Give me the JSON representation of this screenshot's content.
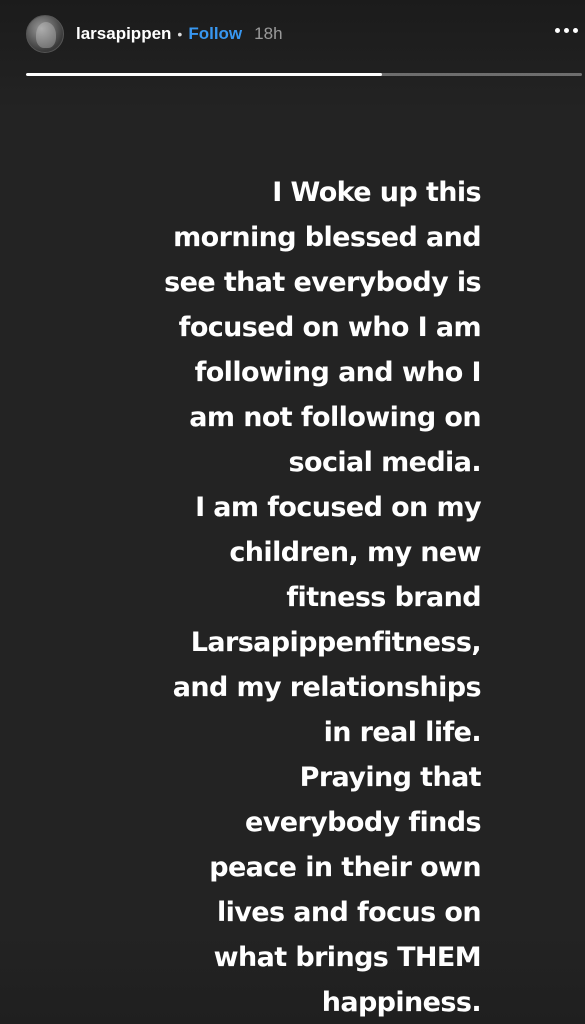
{
  "header": {
    "username": "larsapippen",
    "separator": "•",
    "follow_label": "Follow",
    "timestamp": "18h",
    "more_icon": "more-horizontal-icon"
  },
  "progress": {
    "fraction": 0.64
  },
  "story": {
    "lines": [
      "I Woke up this",
      "morning blessed and",
      "see that everybody is",
      "focused on who I am",
      "following and who I",
      "am not following on",
      "social media.",
      "I am focused on my",
      "children, my new",
      "fitness brand",
      "Larsapippenfitness,",
      "and my relationships",
      "in real life.",
      "Praying that",
      "everybody finds",
      "peace in their own",
      "lives and focus on",
      "what brings THEM",
      "happiness."
    ]
  },
  "colors": {
    "background": "#232323",
    "text": "#ffffff",
    "follow": "#3897f0"
  }
}
